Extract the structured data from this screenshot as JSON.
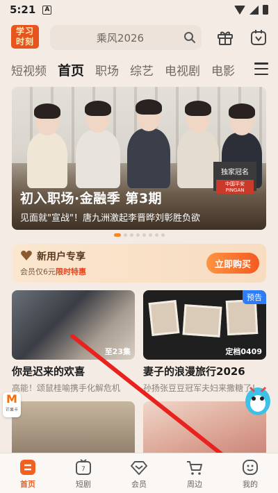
{
  "status_bar": {
    "time": "5:21",
    "notification_icon": "A"
  },
  "header": {
    "logo_text": "学习时刻",
    "search_placeholder": "乘风2026",
    "icons": [
      "gift-icon",
      "sign-in-icon"
    ]
  },
  "tabs": [
    {
      "label": "短视频"
    },
    {
      "label": "首页",
      "active": true
    },
    {
      "label": "职场"
    },
    {
      "label": "综艺"
    },
    {
      "label": "电视剧"
    },
    {
      "label": "电影"
    }
  ],
  "banner": {
    "title": "初入职场·金融季 第3期",
    "subtitle": "见面就\"宣战\"！唐九洲激起李晋晔刘彰胜负欲",
    "badge": "独家冠名",
    "sponsor": "中国平安 PINGAN",
    "carousel_total": 8,
    "carousel_active": 1
  },
  "promo": {
    "title": "新用户专享",
    "desc_prefix": "会员仅6元",
    "desc_highlight": "限时特惠",
    "button": "立即购买",
    "accent": "#f35a21"
  },
  "cards": [
    {
      "title": "你是迟来的欢喜",
      "subtitle": "高能！颂鼠桂喻携手化解危机",
      "tag": "至23集"
    },
    {
      "title": "妻子的浪漫旅行2026",
      "subtitle": "孙扬张豆豆冠军夫妇来撒糖了！",
      "tag": "定档0409",
      "corner": "预告"
    }
  ],
  "side": {
    "mango_label": "芒果卡"
  },
  "nav": [
    {
      "label": "首页",
      "icon": "home-icon",
      "active": true
    },
    {
      "label": "短剧",
      "icon": "short-drama-icon"
    },
    {
      "label": "会员",
      "icon": "vip-icon"
    },
    {
      "label": "周边",
      "icon": "shop-cart-icon"
    },
    {
      "label": "我的",
      "icon": "profile-icon"
    }
  ],
  "colors": {
    "brand": "#f0601e",
    "background": "#f4ece4",
    "arrow": "#e8231f"
  }
}
